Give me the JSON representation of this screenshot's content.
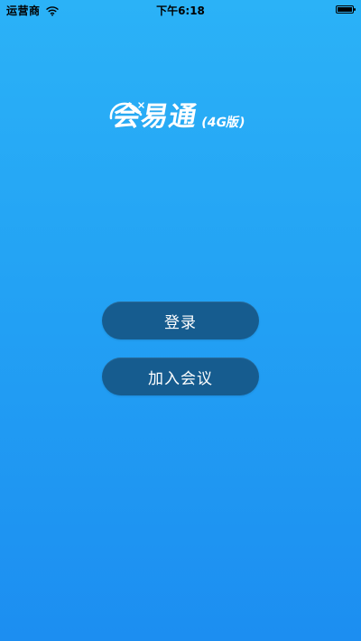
{
  "status_bar": {
    "carrier": "运营商",
    "time": "下午6:18",
    "wifi_icon": "wifi-icon",
    "battery_icon": "battery-icon"
  },
  "logo": {
    "title": "会易通",
    "edition": "(4G版)"
  },
  "buttons": {
    "login": "登录",
    "join_meeting": "加入会议"
  },
  "colors": {
    "background_top": "#2bb2f7",
    "background_bottom": "#1c8ef1",
    "button": "#165c8f",
    "text": "#ffffff"
  }
}
